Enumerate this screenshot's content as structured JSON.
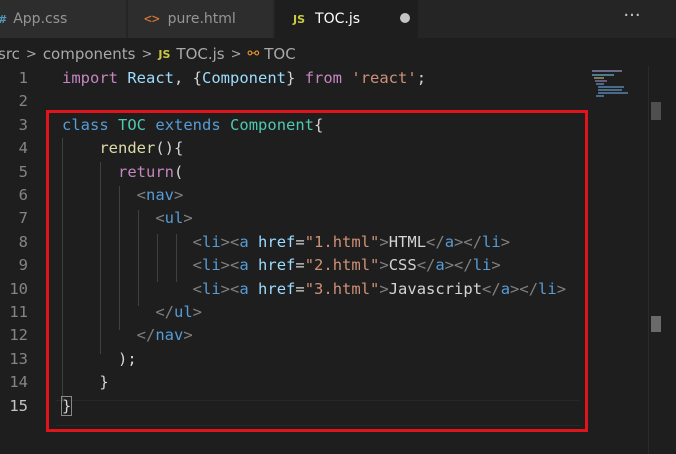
{
  "tabs": [
    {
      "label": "App.css",
      "icon": "css-file-icon",
      "icon_glyph": "#"
    },
    {
      "label": "pure.html",
      "icon": "html-file-icon",
      "icon_glyph": "<>"
    },
    {
      "label": "TOC.js",
      "icon": "js-file-icon",
      "icon_glyph": "JS",
      "active": true,
      "unsaved": true
    }
  ],
  "more_actions_glyph": "···",
  "breadcrumb": {
    "items": [
      "src",
      "components",
      "TOC.js",
      "TOC"
    ],
    "file_icon_glyph": "JS",
    "symbol_icon_glyph": "⚯",
    "separator": ">"
  },
  "editor": {
    "current_line": 15,
    "line_numbers": [
      "1",
      "2",
      "3",
      "4",
      "5",
      "6",
      "7",
      "8",
      "9",
      "10",
      "11",
      "12",
      "13",
      "14",
      "15"
    ],
    "lines": [
      [
        [
          "kw-ctrl",
          "import"
        ],
        [
          "",
          " "
        ],
        [
          "var",
          "React"
        ],
        [
          "",
          ", {"
        ],
        [
          "var",
          "Component"
        ],
        [
          "",
          "} "
        ],
        [
          "kw-ctrl",
          "from"
        ],
        [
          "",
          " "
        ],
        [
          "str",
          "'react'"
        ],
        [
          "",
          ";"
        ]
      ],
      [],
      [
        [
          "kw-blue",
          "class"
        ],
        [
          "",
          " "
        ],
        [
          "cls",
          "TOC"
        ],
        [
          "",
          " "
        ],
        [
          "kw-blue",
          "extends"
        ],
        [
          "",
          " "
        ],
        [
          "cls",
          "Component"
        ],
        [
          "",
          "{"
        ]
      ],
      [
        [
          "",
          "    "
        ],
        [
          "fn",
          "render"
        ],
        [
          "",
          "(){"
        ]
      ],
      [
        [
          "",
          "      "
        ],
        [
          "kw-ctrl",
          "return"
        ],
        [
          "",
          "("
        ]
      ],
      [
        [
          "",
          "        "
        ],
        [
          "punc",
          "<"
        ],
        [
          "tag",
          "nav"
        ],
        [
          "punc",
          ">"
        ]
      ],
      [
        [
          "",
          "          "
        ],
        [
          "punc",
          "<"
        ],
        [
          "tag",
          "ul"
        ],
        [
          "punc",
          ">"
        ]
      ],
      [
        [
          "",
          "              "
        ],
        [
          "punc",
          "<"
        ],
        [
          "tag",
          "li"
        ],
        [
          "punc",
          "><"
        ],
        [
          "tag",
          "a"
        ],
        [
          "",
          " "
        ],
        [
          "attr",
          "href"
        ],
        [
          "",
          "="
        ],
        [
          "str",
          "\"1.html\""
        ],
        [
          "punc",
          ">"
        ],
        [
          "",
          "HTML"
        ],
        [
          "punc",
          "</"
        ],
        [
          "tag",
          "a"
        ],
        [
          "punc",
          "></"
        ],
        [
          "tag",
          "li"
        ],
        [
          "punc",
          ">"
        ]
      ],
      [
        [
          "",
          "              "
        ],
        [
          "punc",
          "<"
        ],
        [
          "tag",
          "li"
        ],
        [
          "punc",
          "><"
        ],
        [
          "tag",
          "a"
        ],
        [
          "",
          " "
        ],
        [
          "attr",
          "href"
        ],
        [
          "",
          "="
        ],
        [
          "str",
          "\"2.html\""
        ],
        [
          "punc",
          ">"
        ],
        [
          "",
          "CSS"
        ],
        [
          "punc",
          "</"
        ],
        [
          "tag",
          "a"
        ],
        [
          "punc",
          "></"
        ],
        [
          "tag",
          "li"
        ],
        [
          "punc",
          ">"
        ]
      ],
      [
        [
          "",
          "              "
        ],
        [
          "punc",
          "<"
        ],
        [
          "tag",
          "li"
        ],
        [
          "punc",
          "><"
        ],
        [
          "tag",
          "a"
        ],
        [
          "",
          " "
        ],
        [
          "attr",
          "href"
        ],
        [
          "",
          "="
        ],
        [
          "str",
          "\"3.html\""
        ],
        [
          "punc",
          ">"
        ],
        [
          "",
          "Javascript"
        ],
        [
          "punc",
          "</"
        ],
        [
          "tag",
          "a"
        ],
        [
          "punc",
          "></"
        ],
        [
          "tag",
          "li"
        ],
        [
          "punc",
          ">"
        ]
      ],
      [
        [
          "",
          "          "
        ],
        [
          "punc",
          "</"
        ],
        [
          "tag",
          "ul"
        ],
        [
          "punc",
          ">"
        ]
      ],
      [
        [
          "",
          "        "
        ],
        [
          "punc",
          "</"
        ],
        [
          "tag",
          "nav"
        ],
        [
          "punc",
          ">"
        ]
      ],
      [
        [
          "",
          "      "
        ],
        [
          "",
          ");"
        ]
      ],
      [
        [
          "",
          "    "
        ],
        [
          "",
          "}"
        ]
      ],
      [
        [
          "",
          "}"
        ]
      ]
    ]
  },
  "colors": {
    "highlight_box": "#e0151b",
    "editor_bg": "#1e1e1e",
    "tab_bar_bg": "#252526"
  }
}
